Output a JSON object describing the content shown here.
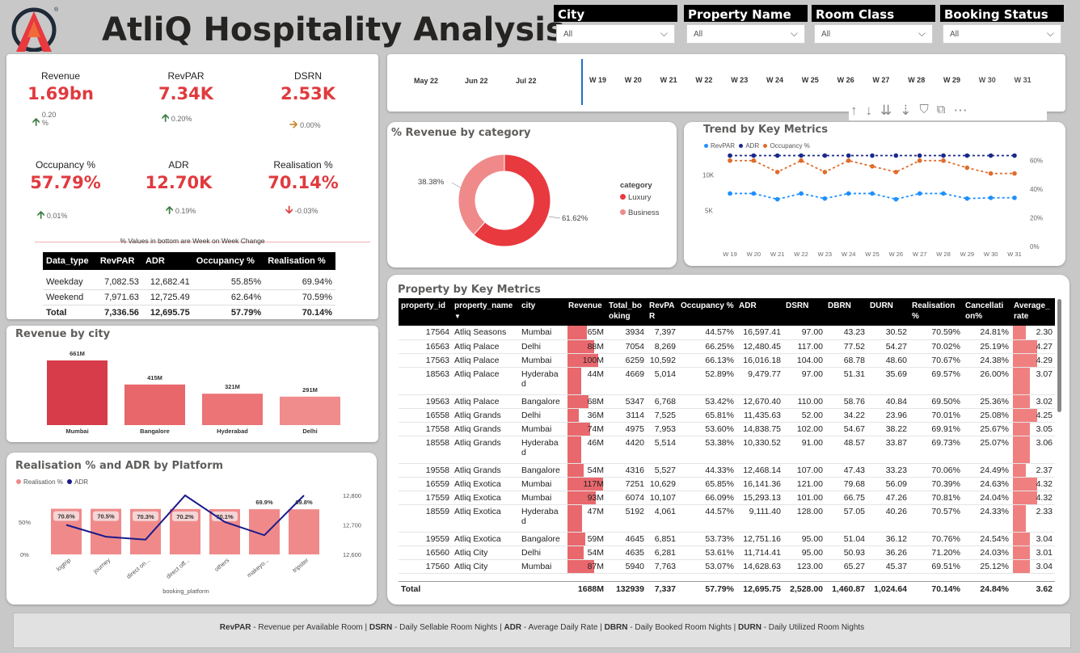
{
  "header": {
    "title": "AtliQ Hospitality Analysis",
    "colors": {
      "accent": "#e03a3e",
      "logo_dark": "#1f2a38"
    }
  },
  "slicers": [
    {
      "label": "City",
      "value": "All"
    },
    {
      "label": "Property Name",
      "value": "All"
    },
    {
      "label": "Room Class",
      "value": "All"
    },
    {
      "label": "Booking Status",
      "value": "All"
    }
  ],
  "kpis": [
    {
      "label": "Revenue",
      "value": "1.69bn",
      "change": "0.20 %",
      "trend": "up"
    },
    {
      "label": "RevPAR",
      "value": "7.34K",
      "change": "0.20%",
      "trend": "up"
    },
    {
      "label": "DSRN",
      "value": "2.53K",
      "change": "0.00%",
      "trend": "flat"
    },
    {
      "label": "Occupancy %",
      "value": "57.79%",
      "change": "0.01%",
      "trend": "up"
    },
    {
      "label": "ADR",
      "value": "12.70K",
      "change": "0.19%",
      "trend": "up"
    },
    {
      "label": "Realisation %",
      "value": "70.14%",
      "change": "-0.03%",
      "trend": "down"
    }
  ],
  "wow_note": "% Values in bottom are Week on Week Change",
  "data_type_table": {
    "headers": [
      "Data_type",
      "RevPAR",
      "ADR",
      "Occupancy %",
      "Realisation %"
    ],
    "rows": [
      [
        "Weekday",
        "7,082.53",
        "12,682.41",
        "55.85%",
        "69.94%"
      ],
      [
        "Weekend",
        "7,971.63",
        "12,725.49",
        "62.64%",
        "70.59%"
      ]
    ],
    "total": [
      "Total",
      "7,336.56",
      "12,695.75",
      "57.79%",
      "70.14%"
    ]
  },
  "timeline": {
    "months": [
      "May 22",
      "Jun 22",
      "Jul 22"
    ],
    "weeks": [
      "W 19",
      "W 20",
      "W 21",
      "W 22",
      "W 23",
      "W 24",
      "W 25",
      "W 26",
      "W 27",
      "W 28",
      "W 29",
      "W 30",
      "W 31"
    ]
  },
  "toolbar_icons": [
    "sort-asc-icon",
    "sort-desc-icon",
    "expand-all-icon",
    "drill-icon",
    "filter-icon",
    "focus-mode-icon",
    "more-options-icon"
  ],
  "revenue_by_category": {
    "title": "% Revenue by category",
    "legend_title": "category",
    "labels": {
      "luxury": "61.62%",
      "business": "38.38%"
    },
    "chart_data": {
      "type": "pie",
      "categories": [
        "Luxury",
        "Business"
      ],
      "values": [
        61.62,
        38.38
      ],
      "colors": [
        "#e8393f",
        "#f08a8a"
      ]
    }
  },
  "trend": {
    "title": "Trend by Key Metrics",
    "legend": [
      "RevPAR",
      "ADR",
      "Occupancy %"
    ],
    "left_ticks": [
      "10K",
      "5K"
    ],
    "right_ticks": [
      "60%",
      "40%",
      "20%",
      "0%"
    ],
    "chart_data": {
      "type": "line",
      "x": [
        "W 19",
        "W 20",
        "W 21",
        "W 22",
        "W 23",
        "W 24",
        "W 25",
        "W 26",
        "W 27",
        "W 28",
        "W 29",
        "W 30",
        "W 31"
      ],
      "series": [
        {
          "name": "RevPAR",
          "axis": "left",
          "color": "#1e90ff",
          "values": [
            7400,
            7400,
            6600,
            7400,
            6700,
            7400,
            7400,
            6600,
            7400,
            7400,
            6700,
            6800,
            6800
          ]
        },
        {
          "name": "ADR",
          "axis": "left",
          "color": "#1a2a8a",
          "values": [
            12700,
            12700,
            12700,
            12700,
            12700,
            12700,
            12700,
            12700,
            12700,
            12700,
            12700,
            12700,
            12700
          ]
        },
        {
          "name": "Occupancy %",
          "axis": "right",
          "color": "#e06c2a",
          "values": [
            60,
            60,
            52,
            60,
            52,
            60,
            56,
            52,
            60,
            60,
            55,
            51,
            51
          ]
        }
      ],
      "ylim_left": [
        0,
        14000
      ],
      "ylim_right": [
        0,
        70
      ]
    }
  },
  "revenue_by_city": {
    "title": "Revenue by city",
    "chart_data": {
      "type": "bar",
      "categories": [
        "Mumbai",
        "Bangalore",
        "Hyderabad",
        "Delhi"
      ],
      "values": [
        661,
        415,
        321,
        291
      ],
      "value_labels": [
        "661M",
        "415M",
        "321M",
        "291M"
      ],
      "colors": [
        "#d63c4a",
        "#e8676a",
        "#ec7376",
        "#f08c8c"
      ]
    }
  },
  "platform": {
    "title": "Realisation % and ADR by Platform",
    "legend": [
      "Realisation %",
      "ADR"
    ],
    "xlabel": "booking_platform",
    "left_ticks": [
      "50%",
      "0%"
    ],
    "right_ticks": [
      "12,800",
      "12,700",
      "12,600"
    ],
    "chart_data": {
      "type": "bar",
      "categories": [
        "logtrip",
        "journey",
        "direct on...",
        "direct off...",
        "others",
        "makeyo...",
        "tripster"
      ],
      "series": [
        {
          "name": "Realisation %",
          "values": [
            70.6,
            70.5,
            70.3,
            70.2,
            70.1,
            69.9,
            69.8
          ],
          "labels": [
            "70.6%",
            "70.5%",
            "70.3%",
            "70.2%",
            "70.1%",
            "69.9%",
            "69.8%"
          ],
          "color": "#f08a8a"
        },
        {
          "name": "ADR",
          "values": [
            12700,
            12660,
            12650,
            12800,
            12710,
            12665,
            12800
          ],
          "color": "#1a1a8a"
        }
      ],
      "ylim_left": [
        0,
        100
      ],
      "ylim_right": [
        12580,
        12820
      ]
    }
  },
  "property_table": {
    "title": "Property by Key Metrics",
    "headers": [
      "property_id",
      "property_name",
      "city",
      "Revenue",
      "Total_bo oking",
      "RevPA R",
      "Occupancy %",
      "ADR",
      "DSRN",
      "DBRN",
      "DURN",
      "Realisation %",
      "Cancellati on%",
      "Average_ rate"
    ],
    "rows": [
      [
        "17564",
        "Atliq Seasons",
        "Mumbai",
        "65M",
        "3934",
        "7,397",
        "44.57%",
        "16,597.41",
        "97.00",
        "43.23",
        "30.52",
        "70.59%",
        "24.81%",
        "2.30"
      ],
      [
        "16563",
        "Atliq Palace",
        "Delhi",
        "88M",
        "7054",
        "8,269",
        "66.25%",
        "12,480.45",
        "117.00",
        "77.52",
        "54.27",
        "70.02%",
        "25.19%",
        "4.27"
      ],
      [
        "17563",
        "Atliq Palace",
        "Mumbai",
        "100M",
        "6259",
        "10,592",
        "66.13%",
        "16,016.18",
        "104.00",
        "68.78",
        "48.60",
        "70.67%",
        "24.38%",
        "4.29"
      ],
      [
        "18563",
        "Atliq Palace",
        "Hyderabad",
        "44M",
        "4669",
        "5,014",
        "52.89%",
        "9,479.77",
        "97.00",
        "51.31",
        "35.69",
        "69.57%",
        "26.00%",
        "3.07"
      ],
      [
        "19563",
        "Atliq Palace",
        "Bangalore",
        "68M",
        "5347",
        "6,768",
        "53.42%",
        "12,670.40",
        "110.00",
        "58.76",
        "40.84",
        "69.50%",
        "25.36%",
        "3.02"
      ],
      [
        "16558",
        "Atliq Grands",
        "Delhi",
        "36M",
        "3114",
        "7,525",
        "65.81%",
        "11,435.63",
        "52.00",
        "34.22",
        "23.96",
        "70.01%",
        "25.08%",
        "4.25"
      ],
      [
        "17558",
        "Atliq Grands",
        "Mumbai",
        "74M",
        "4975",
        "7,953",
        "53.60%",
        "14,838.75",
        "102.00",
        "54.67",
        "38.22",
        "69.91%",
        "25.67%",
        "3.05"
      ],
      [
        "18558",
        "Atliq Grands",
        "Hyderabad",
        "46M",
        "4420",
        "5,514",
        "53.38%",
        "10,330.52",
        "91.00",
        "48.57",
        "33.87",
        "69.73%",
        "25.07%",
        "3.06"
      ],
      [
        "19558",
        "Atliq Grands",
        "Bangalore",
        "54M",
        "4316",
        "5,527",
        "44.33%",
        "12,468.14",
        "107.00",
        "47.43",
        "33.23",
        "70.06%",
        "24.49%",
        "2.37"
      ],
      [
        "16559",
        "Atliq Exotica",
        "Mumbai",
        "117M",
        "7251",
        "10,629",
        "65.85%",
        "16,141.36",
        "121.00",
        "79.68",
        "56.09",
        "70.39%",
        "24.63%",
        "4.32"
      ],
      [
        "17559",
        "Atliq Exotica",
        "Mumbai",
        "93M",
        "6074",
        "10,107",
        "66.09%",
        "15,293.13",
        "101.00",
        "66.75",
        "47.26",
        "70.81%",
        "24.04%",
        "4.32"
      ],
      [
        "18559",
        "Atliq Exotica",
        "Hyderabad",
        "47M",
        "5192",
        "4,061",
        "44.57%",
        "9,111.40",
        "128.00",
        "57.05",
        "40.26",
        "70.57%",
        "24.33%",
        "2.33"
      ],
      [
        "19559",
        "Atliq Exotica",
        "Bangalore",
        "59M",
        "4645",
        "6,851",
        "53.73%",
        "12,751.16",
        "95.00",
        "51.04",
        "36.12",
        "70.76%",
        "24.54%",
        "3.04"
      ],
      [
        "16560",
        "Atliq City",
        "Delhi",
        "54M",
        "4635",
        "6,281",
        "53.61%",
        "11,714.41",
        "95.00",
        "50.93",
        "36.26",
        "71.20%",
        "24.03%",
        "3.01"
      ],
      [
        "17560",
        "Atliq City",
        "Mumbai",
        "87M",
        "5940",
        "7,763",
        "53.07%",
        "14,628.63",
        "123.00",
        "65.27",
        "45.37",
        "69.51%",
        "25.12%",
        "3.04"
      ]
    ],
    "revenue_values": [
      65,
      88,
      100,
      44,
      68,
      36,
      74,
      46,
      54,
      117,
      93,
      47,
      59,
      54,
      87
    ],
    "avg_rate_values": [
      2.3,
      4.27,
      4.29,
      3.07,
      3.02,
      4.25,
      3.05,
      3.06,
      2.37,
      4.32,
      4.32,
      2.33,
      3.04,
      3.01,
      3.04
    ],
    "total": [
      "Total",
      "",
      "",
      "1688M",
      "132939",
      "7,337",
      "57.79%",
      "12,695.75",
      "2,528.00",
      "1,460.87",
      "1,024.64",
      "70.14%",
      "24.84%",
      "3.62"
    ]
  },
  "footer": {
    "items": [
      {
        "abbr": "RevPAR",
        "desc": "Revenue per Available Room"
      },
      {
        "abbr": "DSRN",
        "desc": "Daily Sellable Room Nights"
      },
      {
        "abbr": "ADR",
        "desc": "Average Daily Rate"
      },
      {
        "abbr": "DBRN",
        "desc": "Daily Booked Room Nights"
      },
      {
        "abbr": "DURN",
        "desc": "Daily Utilized Room Nights"
      }
    ]
  }
}
